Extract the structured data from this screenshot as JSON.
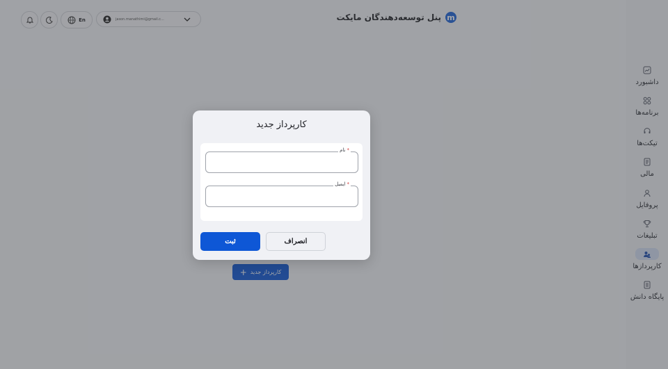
{
  "header": {
    "brand_logo_letter": "m",
    "brand_title": "پنل توسعه‌دهندگان مایکت",
    "language_label": "En",
    "account_email": "jason.manathimi@gmail.c..."
  },
  "sidebar": {
    "items": [
      {
        "label": "داشبورد",
        "icon": "dashboard-icon"
      },
      {
        "label": "برنامه‌ها",
        "icon": "apps-icon"
      },
      {
        "label": "تیکت‌ها",
        "icon": "headset-icon"
      },
      {
        "label": "مالی",
        "icon": "finance-icon"
      },
      {
        "label": "پروفایل",
        "icon": "profile-icon"
      },
      {
        "label": "تبلیغات",
        "icon": "trophy-icon"
      },
      {
        "label": "کارپردازها",
        "icon": "users-icon",
        "active": true
      },
      {
        "label": "پایگاه دانش",
        "icon": "knowledge-icon"
      }
    ]
  },
  "main": {
    "add_agent_button_label": "کارپرداز جدید",
    "add_icon": "+"
  },
  "modal": {
    "title": "کارپرداز جدید",
    "name_label": "نام",
    "name_value": "",
    "email_label": "ایمیل",
    "email_value": "",
    "required_mark": "*",
    "submit_label": "ثبت",
    "cancel_label": "انصراف"
  },
  "colors": {
    "accent": "#0e57d6",
    "overlay": "#3c3e42",
    "required": "#d23b3b"
  }
}
